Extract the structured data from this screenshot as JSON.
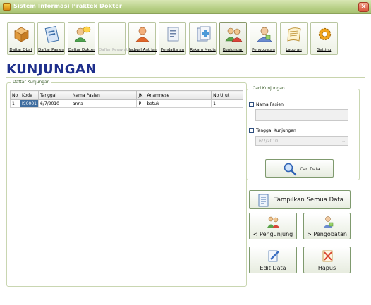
{
  "window": {
    "title": "Sistem Informasi Praktek Dokter",
    "close_glyph": "×"
  },
  "toolbar": {
    "buttons": [
      {
        "label": "Daftar Obat",
        "icon": "box-icon",
        "color": "#e3a04d"
      },
      {
        "label": "Daftar Pasien",
        "icon": "clipboard-icon",
        "color": "#4f8fd6"
      },
      {
        "label": "Daftar Dokter",
        "icon": "doctor-icon",
        "color": "#e8ad3a"
      },
      {
        "label": "Daftar Perawat",
        "icon": "blank",
        "color": "#e0e0e0"
      },
      {
        "label": "Jadwal Antrian",
        "icon": "queue-person-icon",
        "color": "#e1712e"
      },
      {
        "label": "Pendaftaran",
        "icon": "registration-icon",
        "color": "#9aaed0"
      },
      {
        "label": "Rekam Medis",
        "icon": "medical-record-icon",
        "color": "#8aa0c4"
      },
      {
        "label": "Kunjungan",
        "icon": "visitors-icon",
        "color": "#d9a94b"
      },
      {
        "label": "Pengobatan",
        "icon": "treatment-icon",
        "color": "#6b8cd0"
      },
      {
        "label": "Laporan",
        "icon": "report-icon",
        "color": "#e6b45a"
      },
      {
        "label": "Setting",
        "icon": "gear-icon",
        "color": "#f0a21a"
      }
    ]
  },
  "page": {
    "title": "KUNJUNGAN"
  },
  "list_group": {
    "title": "Daftar Kunjungan",
    "columns": [
      "No",
      "Kode",
      "Tanggal",
      "Nama Pasien",
      "JK",
      "Anamnese",
      "No Urut"
    ],
    "rows": [
      {
        "no": "1",
        "kode": "KJ0001",
        "tanggal": "6/7/2010",
        "nama": "anna",
        "jk": "P",
        "anamnese": "batuk",
        "no_urut": "1"
      }
    ]
  },
  "search_group": {
    "title": "Cari Kunjungan",
    "nama_label": "Nama Pasien",
    "nama_value": "",
    "tanggal_label": "Tanggal Kunjungan",
    "tanggal_value": "6/7/2010",
    "cari_label": "Cari Data"
  },
  "actions": {
    "show_all": "Tampilkan Semua Data",
    "to_pengunjung": "< Pengunjung",
    "to_pengobatan": "> Pengobatan",
    "edit": "Edit Data",
    "delete": "Hapus"
  }
}
